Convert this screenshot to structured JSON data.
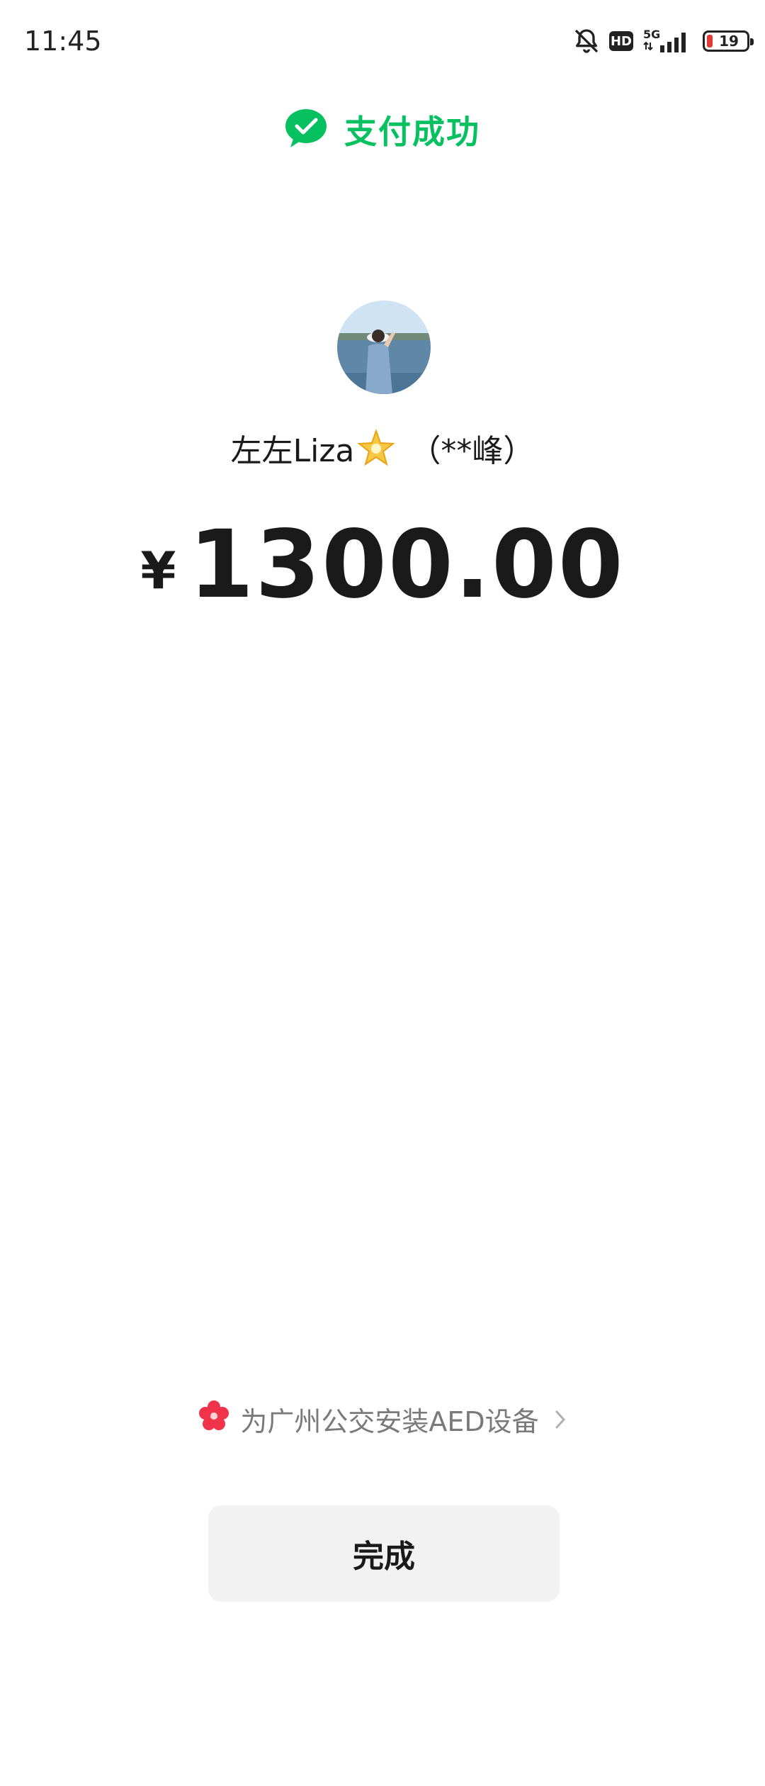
{
  "status_bar": {
    "time": "11:45",
    "network": "5G",
    "hd": "HD",
    "battery": "19",
    "battery_level_percent": 19,
    "icons": [
      "mute-bell-icon",
      "hd-icon",
      "signal-5g-icon",
      "battery-icon"
    ]
  },
  "header": {
    "title": "支付成功",
    "icon": "wechat-pay-check-icon",
    "accent_color": "#07c160"
  },
  "recipient": {
    "name": "左左Liza",
    "emoji": "star-icon",
    "masked_name": "（**峰）"
  },
  "payment": {
    "currency_symbol": "¥",
    "amount": "1300.00"
  },
  "promo": {
    "text": "为广州公交安装AED设备",
    "icon": "flower-icon",
    "icon_color": "#f0334a"
  },
  "actions": {
    "done_label": "完成"
  }
}
